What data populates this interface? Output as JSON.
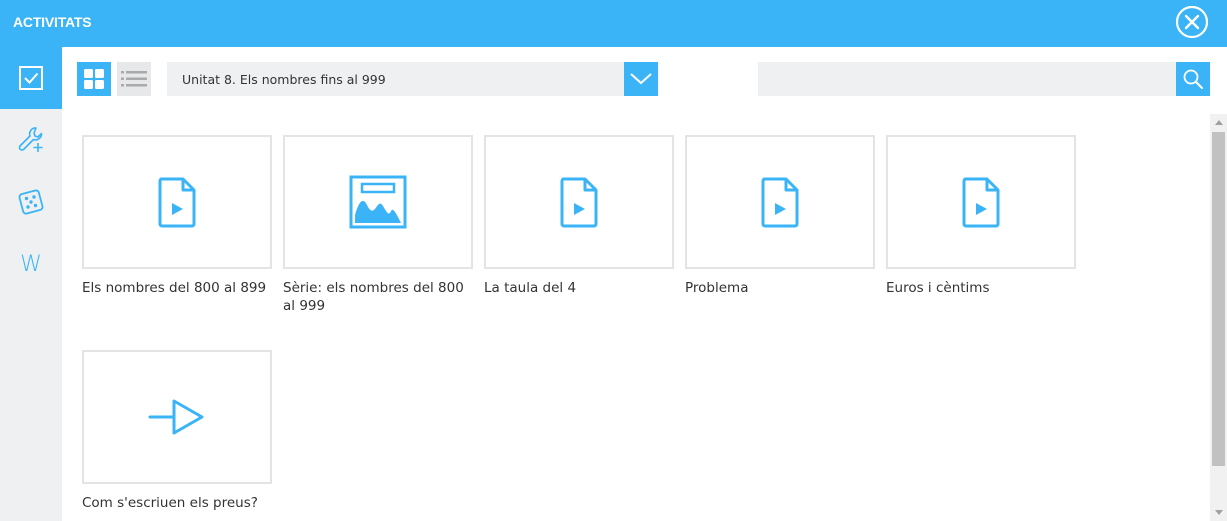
{
  "header": {
    "title": "ACTIVITATS"
  },
  "sidebar": {
    "items": [
      {
        "icon": "checkbox-icon",
        "active": true
      },
      {
        "icon": "wrench-plus-icon",
        "active": false
      },
      {
        "icon": "dice-icon",
        "active": false
      },
      {
        "icon": "w-letter-icon",
        "glyph": "W",
        "active": false
      }
    ]
  },
  "toolbar": {
    "unit_selected": "Unitat 8. Els nombres fins al 999",
    "search_placeholder": ""
  },
  "cards": [
    {
      "title": "Els nombres del 800 al 899",
      "icon": "document-play-icon"
    },
    {
      "title": "Sèrie: els nombres del 800 al 999",
      "icon": "image-icon"
    },
    {
      "title": "La taula del 4",
      "icon": "document-play-icon"
    },
    {
      "title": "Problema",
      "icon": "document-play-icon"
    },
    {
      "title": "Euros i cèntims",
      "icon": "document-play-icon"
    },
    {
      "title": "Com s'escriuen els preus?",
      "icon": "arrow-link-icon"
    }
  ],
  "colors": {
    "accent": "#3ab4f7",
    "sidebar_bg": "#eef0f2",
    "text": "#333333"
  }
}
